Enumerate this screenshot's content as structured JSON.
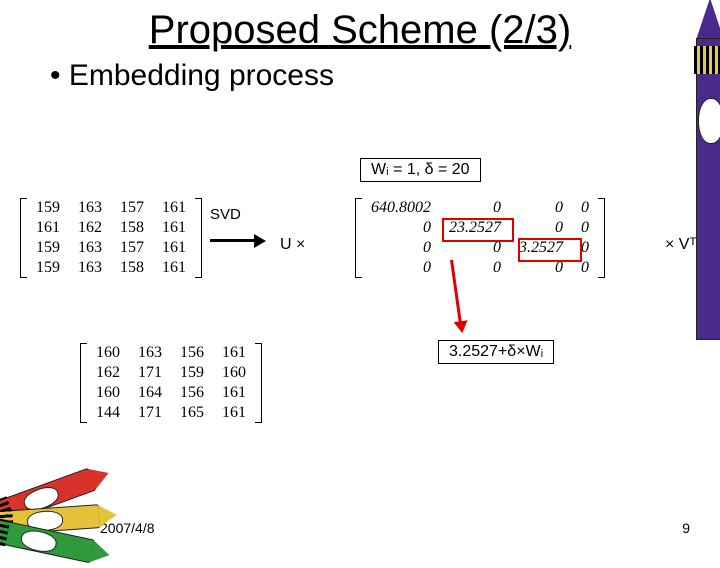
{
  "title": "Proposed Scheme (2/3)",
  "bullet": "Embedding process",
  "params_box": "Wᵢ = 1, δ = 20",
  "labels": {
    "svd": "SVD",
    "ux": "U ×",
    "vt": "× Vᵀ"
  },
  "matrix_A": [
    [
      159,
      163,
      157,
      161
    ],
    [
      161,
      162,
      158,
      161
    ],
    [
      159,
      163,
      157,
      161
    ],
    [
      159,
      163,
      158,
      161
    ]
  ],
  "matrix_B": [
    [
      160,
      163,
      156,
      161
    ],
    [
      162,
      171,
      159,
      160
    ],
    [
      160,
      164,
      156,
      161
    ],
    [
      144,
      171,
      165,
      161
    ]
  ],
  "matrix_S": [
    [
      "640.8002",
      "0",
      "0",
      "0"
    ],
    [
      "0",
      "23.2527",
      "0",
      "0"
    ],
    [
      "0",
      "0",
      "3.2527",
      "0"
    ],
    [
      "0",
      "0",
      "0",
      "0"
    ]
  ],
  "highlight1": "23.2527",
  "highlight2": "3.2527",
  "formula": "3.2527+δ×Wᵢ",
  "date": "2007/4/8",
  "page": "9"
}
